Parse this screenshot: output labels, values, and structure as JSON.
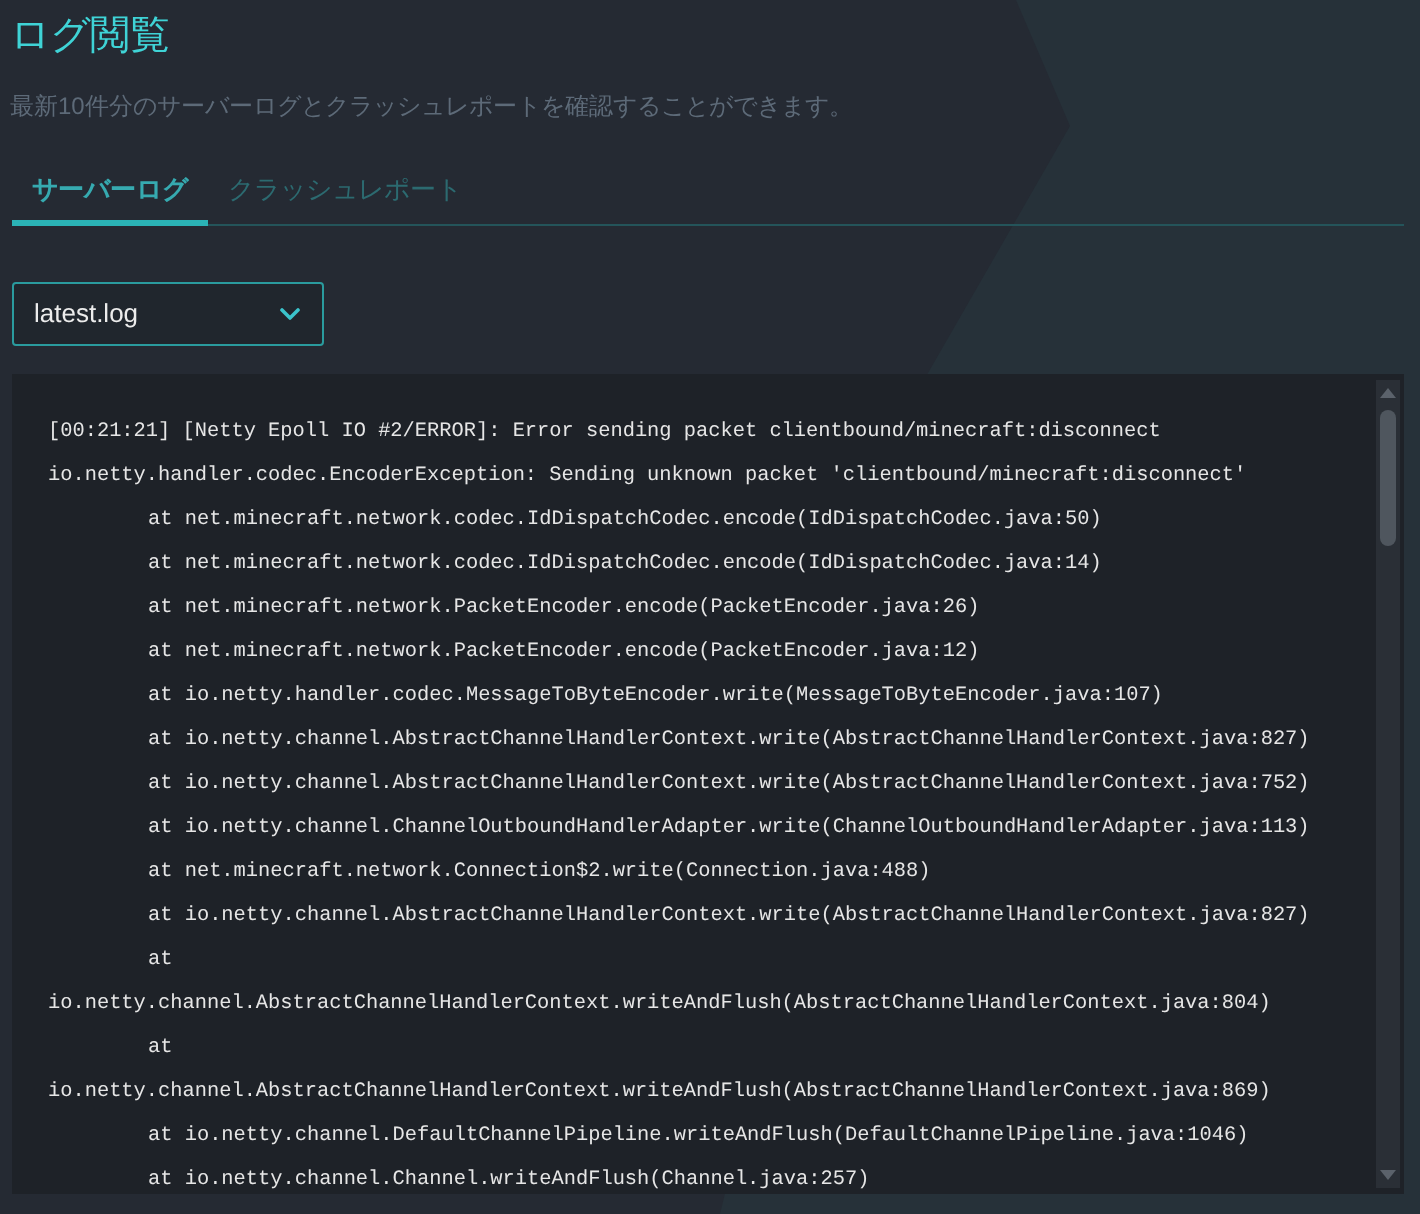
{
  "page": {
    "title": "ログ閲覧",
    "description": "最新10件分のサーバーログとクラッシュレポートを確認することができます。"
  },
  "tabs": [
    {
      "label": "サーバーログ",
      "selected": true
    },
    {
      "label": "クラッシュレポート",
      "selected": false
    }
  ],
  "file_select": {
    "value": "latest.log"
  },
  "log": {
    "lines": [
      {
        "text": "[00:21:21] [Netty Epoll IO #2/ERROR]: Error sending packet clientbound/minecraft:disconnect",
        "indented": false
      },
      {
        "text": "io.netty.handler.codec.EncoderException: Sending unknown packet 'clientbound/minecraft:disconnect'",
        "indented": false
      },
      {
        "text": "at net.minecraft.network.codec.IdDispatchCodec.encode(IdDispatchCodec.java:50)",
        "indented": true
      },
      {
        "text": "at net.minecraft.network.codec.IdDispatchCodec.encode(IdDispatchCodec.java:14)",
        "indented": true
      },
      {
        "text": "at net.minecraft.network.PacketEncoder.encode(PacketEncoder.java:26)",
        "indented": true
      },
      {
        "text": "at net.minecraft.network.PacketEncoder.encode(PacketEncoder.java:12)",
        "indented": true
      },
      {
        "text": "at io.netty.handler.codec.MessageToByteEncoder.write(MessageToByteEncoder.java:107)",
        "indented": true
      },
      {
        "text": "at io.netty.channel.AbstractChannelHandlerContext.write(AbstractChannelHandlerContext.java:827)",
        "indented": true
      },
      {
        "text": "at io.netty.channel.AbstractChannelHandlerContext.write(AbstractChannelHandlerContext.java:752)",
        "indented": true
      },
      {
        "text": "at io.netty.channel.ChannelOutboundHandlerAdapter.write(ChannelOutboundHandlerAdapter.java:113)",
        "indented": true
      },
      {
        "text": "at net.minecraft.network.Connection$2.write(Connection.java:488)",
        "indented": true
      },
      {
        "text": "at io.netty.channel.AbstractChannelHandlerContext.write(AbstractChannelHandlerContext.java:827)",
        "indented": true
      },
      {
        "text": "at",
        "indented": true
      },
      {
        "text": "io.netty.channel.AbstractChannelHandlerContext.writeAndFlush(AbstractChannelHandlerContext.java:804)",
        "indented": false
      },
      {
        "text": "at",
        "indented": true
      },
      {
        "text": "io.netty.channel.AbstractChannelHandlerContext.writeAndFlush(AbstractChannelHandlerContext.java:869)",
        "indented": false
      },
      {
        "text": "at io.netty.channel.DefaultChannelPipeline.writeAndFlush(DefaultChannelPipeline.java:1046)",
        "indented": true
      },
      {
        "text": "at io.netty.channel.Channel.writeAndFlush(Channel.java:257)",
        "indented": true
      }
    ]
  }
}
